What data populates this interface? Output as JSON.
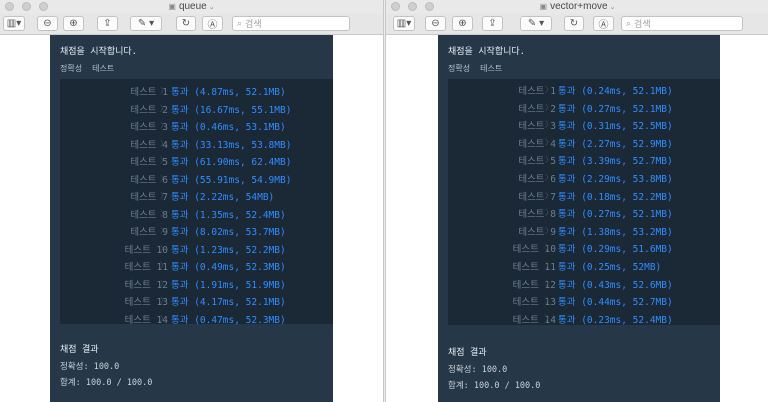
{
  "windows": [
    {
      "id": "left",
      "title": "queue",
      "search_placeholder": "검색",
      "grading_start": "채점을 시작합니다.",
      "tabs": [
        "정확성",
        "테스트"
      ],
      "tests": [
        {
          "label": "테스트 1",
          "result": "통과 (4.87ms, 52.1MB)"
        },
        {
          "label": "테스트 2",
          "result": "통과 (16.67ms, 55.1MB)"
        },
        {
          "label": "테스트 3",
          "result": "통과 (0.46ms, 53.1MB)"
        },
        {
          "label": "테스트 4",
          "result": "통과 (33.13ms, 53.8MB)"
        },
        {
          "label": "테스트 5",
          "result": "통과 (61.90ms, 62.4MB)"
        },
        {
          "label": "테스트 6",
          "result": "통과 (55.91ms, 54.9MB)"
        },
        {
          "label": "테스트 7",
          "result": "통과 (2.22ms, 54MB)"
        },
        {
          "label": "테스트 8",
          "result": "통과 (1.35ms, 52.4MB)"
        },
        {
          "label": "테스트 9",
          "result": "통과 (8.02ms, 53.7MB)"
        },
        {
          "label": "테스트 10",
          "result": "통과 (1.23ms, 52.2MB)"
        },
        {
          "label": "테스트 11",
          "result": "통과 (0.49ms, 52.3MB)"
        },
        {
          "label": "테스트 12",
          "result": "통과 (1.91ms, 51.9MB)"
        },
        {
          "label": "테스트 13",
          "result": "통과 (4.17ms, 52.1MB)"
        },
        {
          "label": "테스트 14",
          "result": "통과 (0.47ms, 52.3MB)"
        }
      ],
      "summary_title": "채점 결과",
      "accuracy": "정확성: 100.0",
      "total": "합계: 100.0 / 100.0"
    },
    {
      "id": "right",
      "title": "vector+move",
      "search_placeholder": "검색",
      "grading_start": "채점을 시작합니다.",
      "tabs": [
        "정확성",
        "테스트"
      ],
      "tests": [
        {
          "label": "테스트 1",
          "result": "통과 (0.24ms, 52.1MB)"
        },
        {
          "label": "테스트 2",
          "result": "통과 (0.27ms, 52.1MB)"
        },
        {
          "label": "테스트 3",
          "result": "통과 (0.31ms, 52.5MB)"
        },
        {
          "label": "테스트 4",
          "result": "통과 (2.27ms, 52.9MB)"
        },
        {
          "label": "테스트 5",
          "result": "통과 (3.39ms, 52.7MB)"
        },
        {
          "label": "테스트 6",
          "result": "통과 (2.29ms, 53.8MB)"
        },
        {
          "label": "테스트 7",
          "result": "통과 (0.18ms, 52.2MB)"
        },
        {
          "label": "테스트 8",
          "result": "통과 (0.27ms, 52.1MB)"
        },
        {
          "label": "테스트 9",
          "result": "통과 (1.38ms, 53.2MB)"
        },
        {
          "label": "테스트 10",
          "result": "통과 (0.29ms, 51.6MB)"
        },
        {
          "label": "테스트 11",
          "result": "통과 (0.25ms, 52MB)"
        },
        {
          "label": "테스트 12",
          "result": "통과 (0.43ms, 52.6MB)"
        },
        {
          "label": "테스트 13",
          "result": "통과 (0.44ms, 52.7MB)"
        },
        {
          "label": "테스트 14",
          "result": "통과 (0.23ms, 52.4MB)"
        }
      ],
      "summary_title": "채점 결과",
      "accuracy": "정확성: 100.0",
      "total": "합계: 100.0 / 100.0"
    }
  ],
  "icons": {
    "sidebar": "sidebar-toggle-icon",
    "zoom_out": "zoom-out-icon",
    "zoom_in": "zoom-in-icon",
    "share": "share-icon",
    "markup": "pencil-icon",
    "rotate": "rotate-icon",
    "annotate": "markup-circle-icon",
    "search": "search-icon"
  },
  "colors": {
    "panel_bg": "#263747",
    "results_bg": "#1b2836",
    "pass_text": "#2f8dff",
    "label_text": "#6d7e8e"
  }
}
